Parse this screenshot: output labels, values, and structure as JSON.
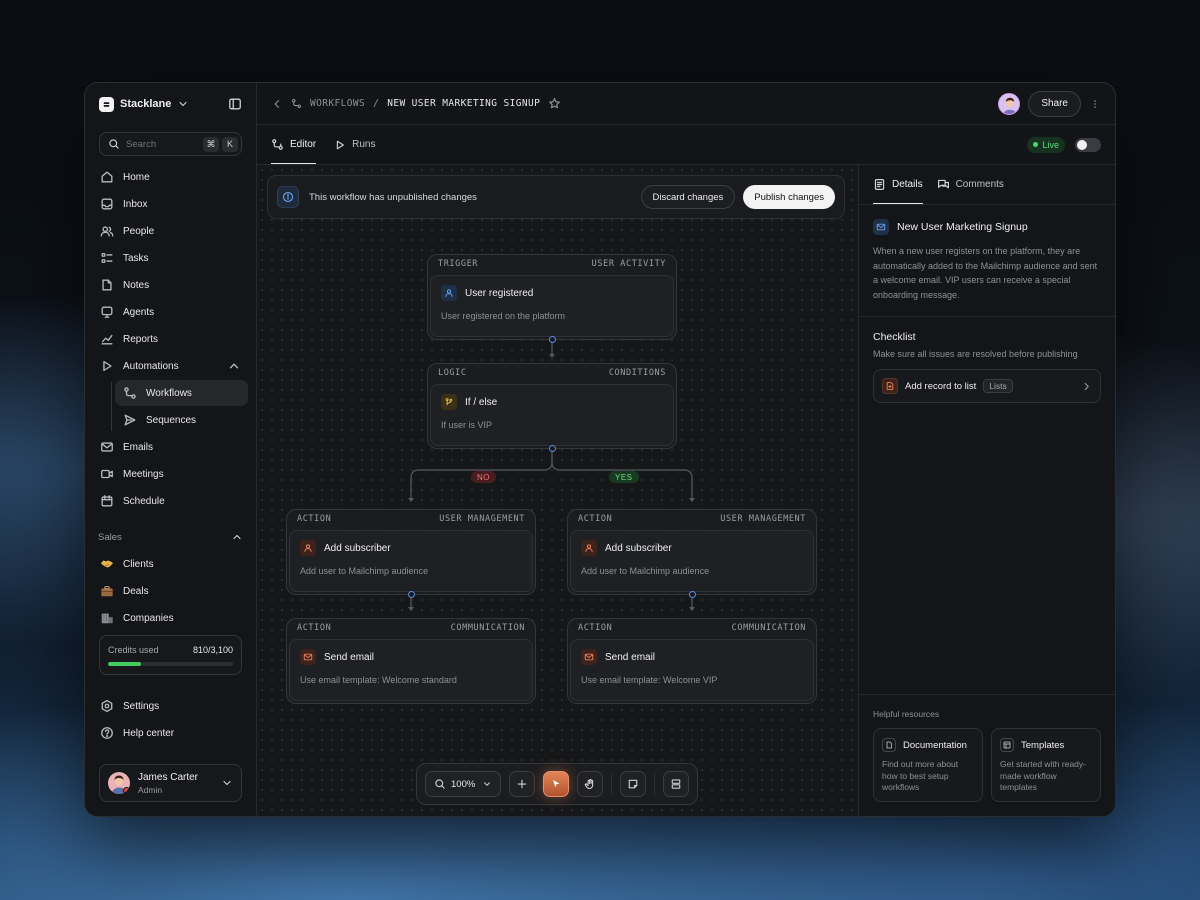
{
  "workspace": {
    "name": "Stacklane"
  },
  "search": {
    "placeholder": "Search",
    "shortcut": [
      "⌘",
      "K"
    ]
  },
  "nav": {
    "items": [
      {
        "label": "Home",
        "icon": "home-icon"
      },
      {
        "label": "Inbox",
        "icon": "inbox-icon"
      },
      {
        "label": "People",
        "icon": "people-icon"
      },
      {
        "label": "Tasks",
        "icon": "tasks-icon"
      },
      {
        "label": "Notes",
        "icon": "notes-icon"
      },
      {
        "label": "Agents",
        "icon": "agents-icon"
      },
      {
        "label": "Reports",
        "icon": "reports-icon"
      },
      {
        "label": "Automations",
        "icon": "play-icon"
      }
    ],
    "automations_sub": [
      {
        "label": "Workflows",
        "icon": "workflow-icon",
        "active": true
      },
      {
        "label": "Sequences",
        "icon": "send-icon"
      }
    ],
    "items2": [
      {
        "label": "Emails",
        "icon": "mail-icon"
      },
      {
        "label": "Meetings",
        "icon": "video-icon"
      },
      {
        "label": "Schedule",
        "icon": "calendar-icon"
      }
    ],
    "sales_label": "Sales",
    "sales": [
      {
        "label": "Clients",
        "icon": "handshake-icon",
        "color": "#e8b34b"
      },
      {
        "label": "Deals",
        "icon": "briefcase-icon",
        "color": "#9a6a43"
      },
      {
        "label": "Companies",
        "icon": "building-icon",
        "color": "#8a8e96"
      }
    ],
    "bottom": [
      {
        "label": "Settings",
        "icon": "settings-icon"
      },
      {
        "label": "Help center",
        "icon": "help-icon"
      }
    ]
  },
  "credits": {
    "label": "Credits used",
    "value": "810/3,100",
    "used": 810,
    "total": 3100
  },
  "user": {
    "name": "James Carter",
    "role": "Admin"
  },
  "breadcrumb": {
    "parent": "WORKFLOWS",
    "current": "NEW USER MARKETING SIGNUP"
  },
  "topbar": {
    "share_label": "Share"
  },
  "tabs": {
    "editor": "Editor",
    "runs": "Runs",
    "live_label": "Live"
  },
  "banner": {
    "text": "This workflow has unpublished changes",
    "discard": "Discard changes",
    "publish": "Publish changes"
  },
  "nodes": {
    "trigger": {
      "kind": "TRIGGER",
      "category": "USER ACTIVITY",
      "title": "User registered",
      "subtitle": "User registered on the platform"
    },
    "logic": {
      "kind": "LOGIC",
      "category": "CONDITIONS",
      "title": "If / else",
      "subtitle": "If user is VIP"
    },
    "action_left": {
      "kind": "ACTION",
      "category": "USER MANAGEMENT",
      "title": "Add subscriber",
      "subtitle": "Add user to Mailchimp audience"
    },
    "action_right": {
      "kind": "ACTION",
      "category": "USER MANAGEMENT",
      "title": "Add subscriber",
      "subtitle": "Add user to Mailchimp audience"
    },
    "email_left": {
      "kind": "ACTION",
      "category": "COMMUNICATION",
      "title": "Send email",
      "subtitle": "Use email template: Welcome standard"
    },
    "email_right": {
      "kind": "ACTION",
      "category": "COMMUNICATION",
      "title": "Send email",
      "subtitle": "Use email template: Welcome VIP"
    }
  },
  "branches": {
    "no": "NO",
    "yes": "YES"
  },
  "toolbar": {
    "zoom": "100%"
  },
  "panel": {
    "tabs": {
      "details": "Details",
      "comments": "Comments"
    },
    "title": "New User Marketing Signup",
    "description": "When a new user registers on the platform, they are automatically added to the Mailchimp audience and sent a welcome email. VIP users can receive a special onboarding message.",
    "checklist": {
      "title": "Checklist",
      "subtitle": "Make sure all issues are resolved before publishing",
      "item": "Add record to list",
      "badge": "Lists"
    },
    "resources": {
      "label": "Helpful resources",
      "docs_title": "Documentation",
      "docs_desc": "Find out more about how to best setup workflows",
      "templates_title": "Templates",
      "templates_desc": "Get started with ready-made workflow templates"
    }
  },
  "colors": {
    "accent_live": "#4bd66b",
    "accent_tool": "#e2865a",
    "port": "#5a8ee0"
  }
}
